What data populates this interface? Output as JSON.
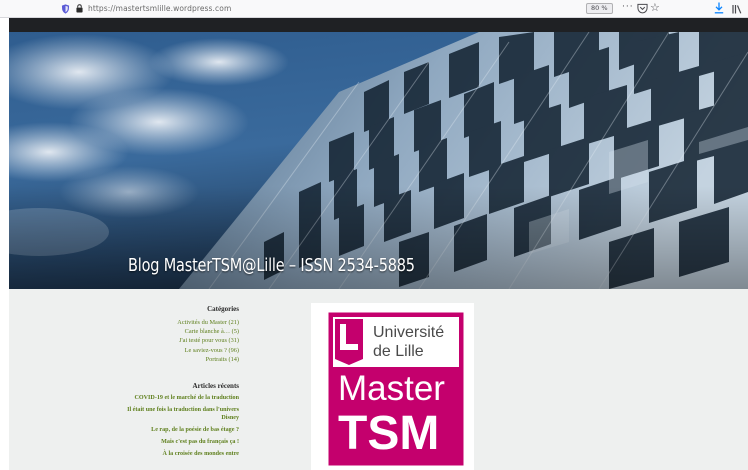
{
  "browser": {
    "url": "https://mastertsmlille.wordpress.com",
    "zoom": "80 %",
    "more_menu": "···"
  },
  "site": {
    "title": "Blog MasterTSM@Lille – ISSN 2534-5885"
  },
  "sidebar": {
    "categories_title": "Catégories",
    "categories": [
      "Activités du Master (21)",
      "Carte blanche à… (5)",
      "J'ai testé pour vous (31)",
      "Le saviez-vous ? (96)",
      "Portraits (14)"
    ],
    "recent_title": "Articles récents",
    "recent": [
      "COVID-19 et le marché de la traduction",
      "Il était une fois la traduction dans l'univers Disney",
      "Le rap, de la poésie de bas étage ?",
      "Mais c'est pas du français ça !",
      "À la croisée des mondes entre"
    ]
  },
  "logo": {
    "line1": "Université",
    "line2": "de Lille",
    "line3": "Master",
    "line4": "TSM",
    "brand_color": "#c4006d"
  }
}
